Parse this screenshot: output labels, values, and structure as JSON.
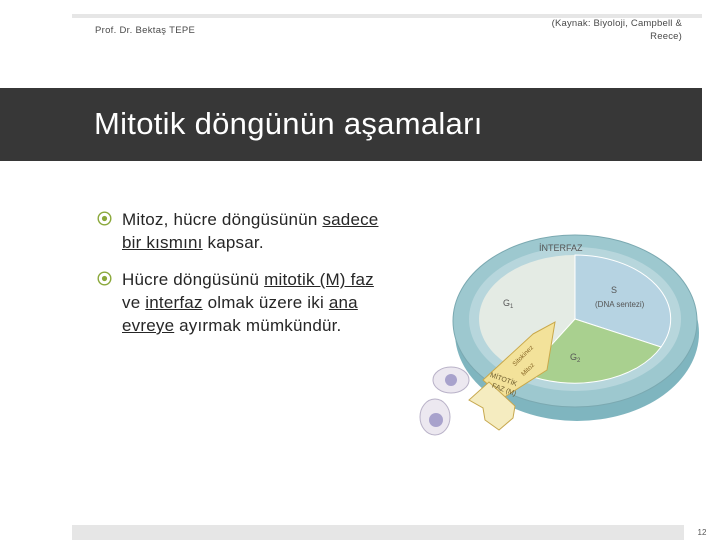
{
  "header": {
    "author": "Prof. Dr. Bektaş TEPE",
    "source": "(Kaynak: Biyoloji, Campbell & Reece)"
  },
  "slide": {
    "title": "Mitotik döngünün aşamaları",
    "page_number": "12"
  },
  "bullets": [
    {
      "icon": "circle-target-icon",
      "parts": [
        "Mitoz, hücre döngüsünün ",
        "sadece bir kısmını",
        " kapsar."
      ]
    },
    {
      "icon": "circle-target-icon",
      "parts": [
        "Hücre döngüsünü ",
        "mitotik (M) faz",
        " ve ",
        "interfaz",
        " olmak üzere iki ",
        "ana evreye",
        " ayırmak mümkündür."
      ]
    }
  ],
  "figure": {
    "interphase_label": "İNTERFAZ",
    "g1_label": "G",
    "g1_sub": "1",
    "s_label": "S",
    "s_sub_label": "(DNA sentezi)",
    "g2_label": "G",
    "g2_sub": "2",
    "cytokinesis_label": "Sitokinez",
    "mitosis_label": "Mitoz",
    "mphase_line1": "MİTOTİK",
    "mphase_line2": "FAZ (M)",
    "colors": {
      "g1": "#e4ebe4",
      "s": "#b6d3e2",
      "g2": "#a9d08f",
      "rim": "#9dc8cf",
      "m_phase": "#f3e29a",
      "title_band": "#373737"
    }
  }
}
